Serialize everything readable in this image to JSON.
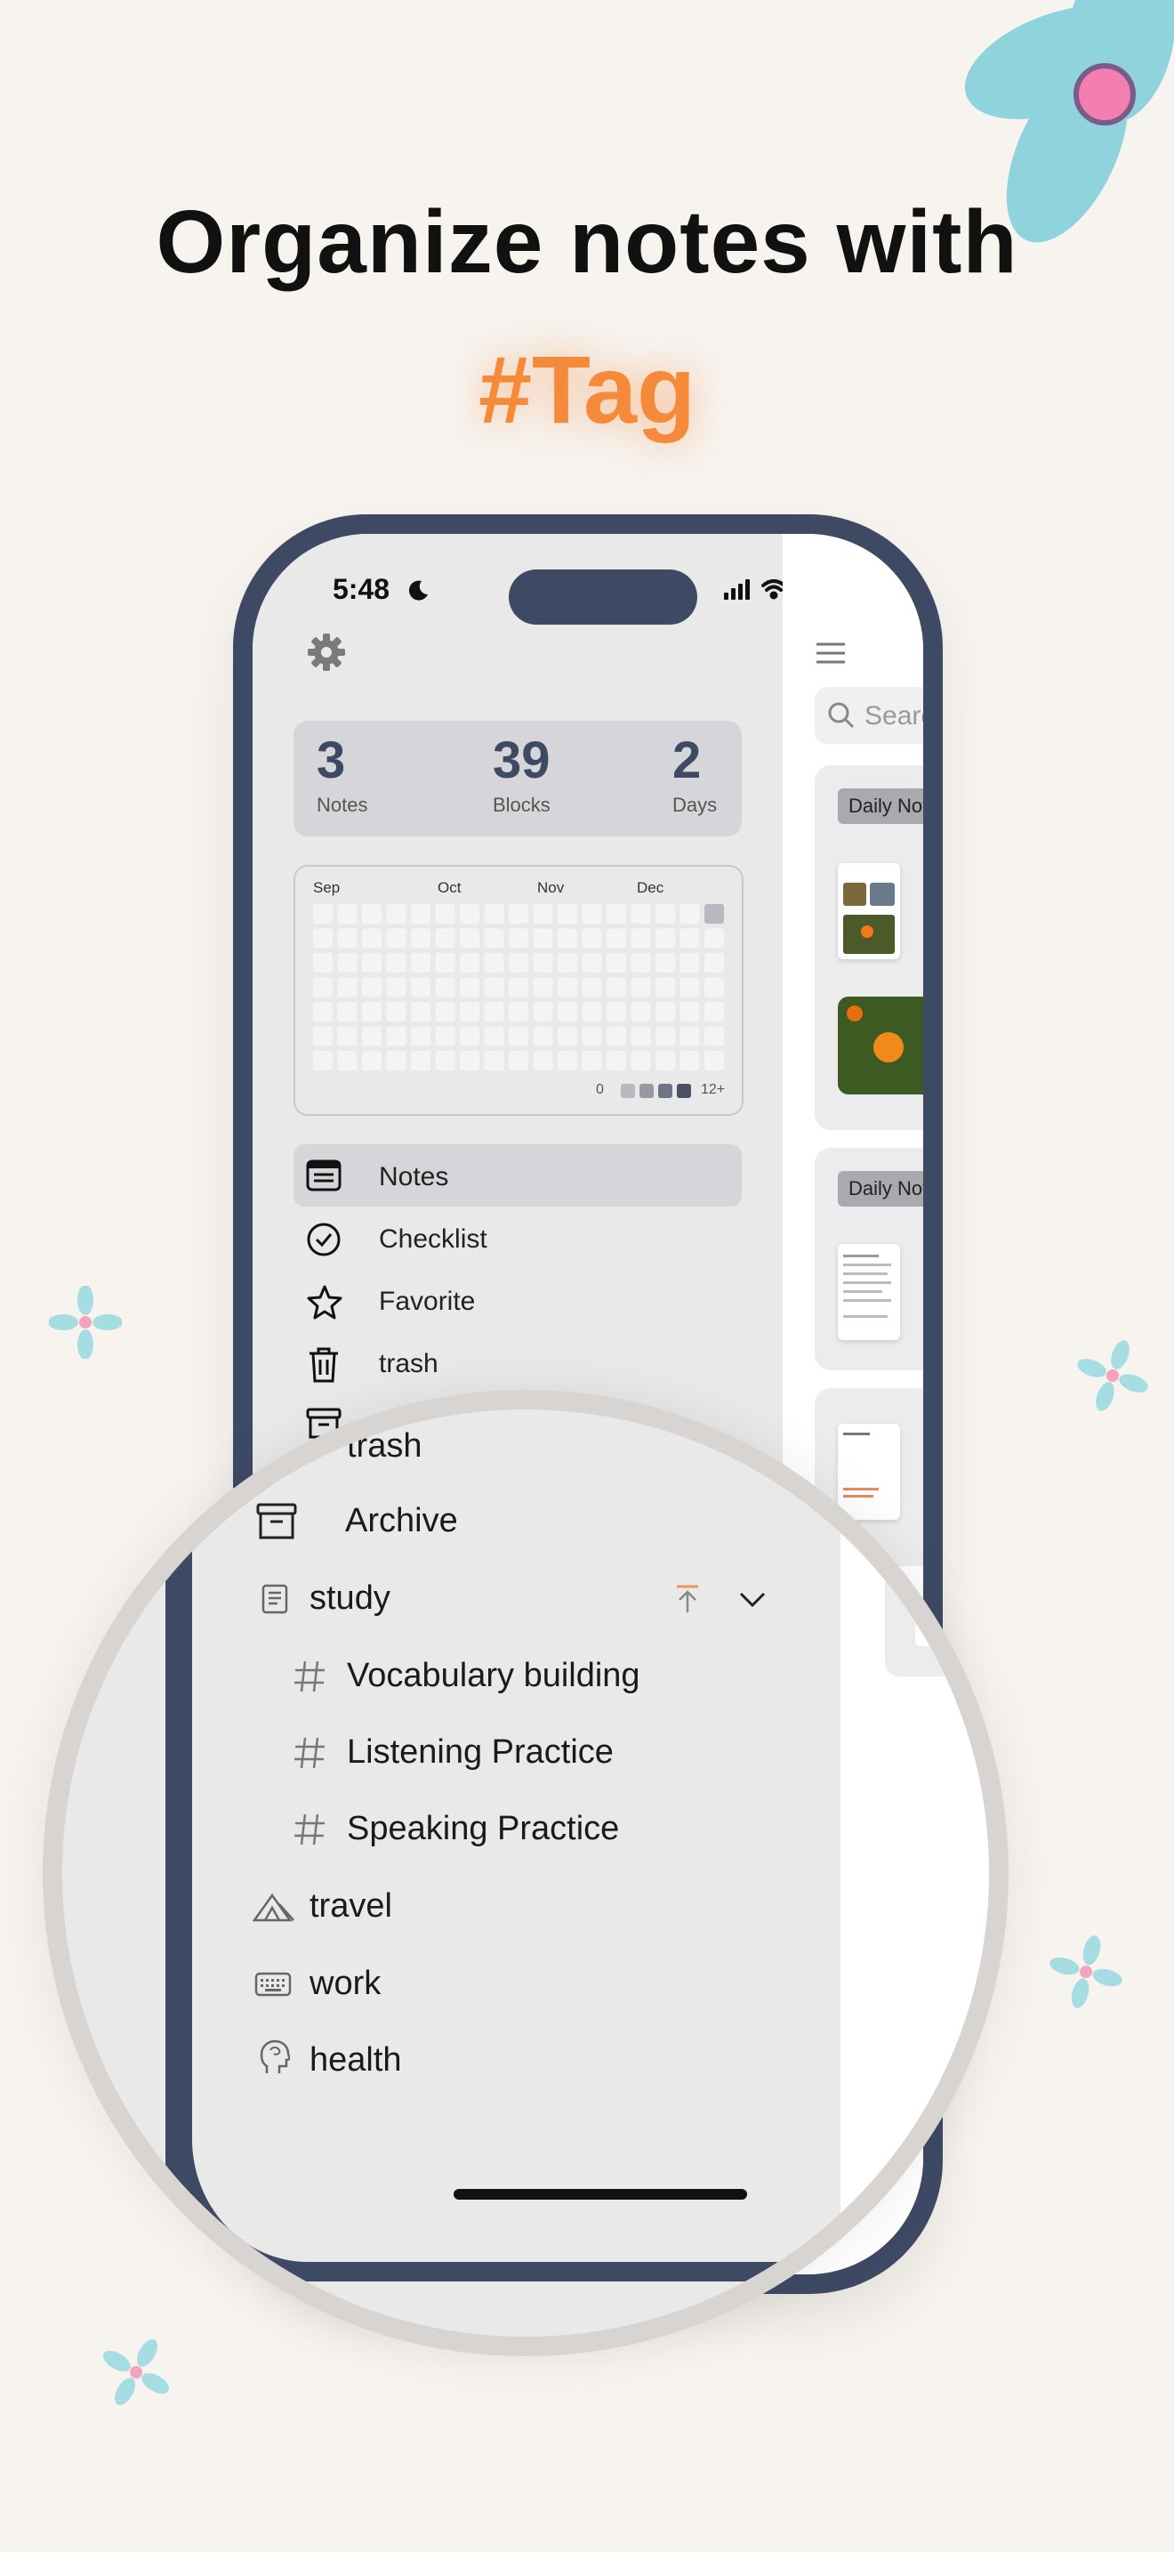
{
  "headline": "Organize notes with",
  "tagline": "#Tag",
  "status": {
    "time": "5:48"
  },
  "stats": [
    {
      "value": "3",
      "label": "Notes"
    },
    {
      "value": "39",
      "label": "Blocks"
    },
    {
      "value": "2",
      "label": "Days"
    }
  ],
  "heatmap": {
    "months": [
      "Sep",
      "Oct",
      "Nov",
      "Dec"
    ],
    "legend_min": "0",
    "legend_max": "12+"
  },
  "menu": [
    {
      "label": "Notes",
      "icon": "notes-icon",
      "active": true
    },
    {
      "label": "Checklist",
      "icon": "checklist-icon"
    },
    {
      "label": "Favorite",
      "icon": "star-icon"
    },
    {
      "label": "trash",
      "icon": "trash-icon"
    }
  ],
  "side_panel": {
    "search_placeholder": "Searc",
    "cards": [
      {
        "tag": "Daily Not"
      },
      {
        "tag": "Daily Not"
      }
    ]
  },
  "magnified": {
    "trash": "trash",
    "archive": "Archive",
    "tags": [
      {
        "label": "study",
        "icon": "document-icon",
        "children": [
          {
            "label": "Vocabulary building"
          },
          {
            "label": "Listening Practice"
          },
          {
            "label": "Speaking Practice"
          }
        ]
      },
      {
        "label": "travel",
        "icon": "tent-icon"
      },
      {
        "label": "work",
        "icon": "keyboard-icon"
      },
      {
        "label": "health",
        "icon": "brain-icon"
      }
    ]
  },
  "colors": {
    "accent": "#f58a3a",
    "frame": "#3e4a64",
    "background": "#f7f3ef"
  }
}
